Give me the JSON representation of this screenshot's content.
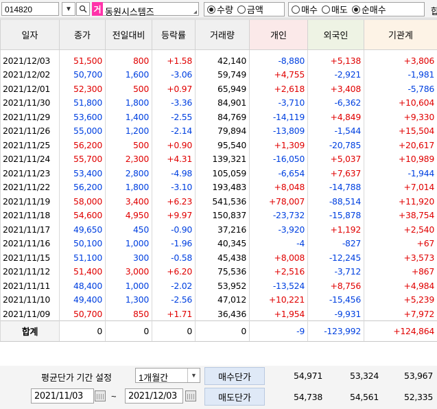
{
  "toolbar": {
    "code": "014820",
    "badge": "거",
    "name": "동원시스템즈",
    "radio_qty": "수량",
    "radio_amt": "금액",
    "radio_buy": "매수",
    "radio_sell": "매도",
    "radio_net": "순매수",
    "cut": "합"
  },
  "headers": [
    "일자",
    "종가",
    "전일대비",
    "등락률",
    "거래량",
    "개인",
    "외국인",
    "기관계"
  ],
  "rows": [
    [
      "2021/12/03",
      "51,500",
      "800",
      "+1.58",
      "42,140",
      "-8,880",
      "+5,138",
      "+3,806"
    ],
    [
      "2021/12/02",
      "50,700",
      "1,600",
      "-3.06",
      "59,749",
      "+4,755",
      "-2,921",
      "-1,981"
    ],
    [
      "2021/12/01",
      "52,300",
      "500",
      "+0.97",
      "65,949",
      "+2,618",
      "+3,408",
      "-5,786"
    ],
    [
      "2021/11/30",
      "51,800",
      "1,800",
      "-3.36",
      "84,901",
      "-3,710",
      "-6,362",
      "+10,604"
    ],
    [
      "2021/11/29",
      "53,600",
      "1,400",
      "-2.55",
      "84,769",
      "-14,119",
      "+4,849",
      "+9,330"
    ],
    [
      "2021/11/26",
      "55,000",
      "1,200",
      "-2.14",
      "79,894",
      "-13,809",
      "-1,544",
      "+15,504"
    ],
    [
      "2021/11/25",
      "56,200",
      "500",
      "+0.90",
      "95,540",
      "+1,309",
      "-20,785",
      "+20,617"
    ],
    [
      "2021/11/24",
      "55,700",
      "2,300",
      "+4.31",
      "139,321",
      "-16,050",
      "+5,037",
      "+10,989"
    ],
    [
      "2021/11/23",
      "53,400",
      "2,800",
      "-4.98",
      "105,059",
      "-6,654",
      "+7,637",
      "-1,944"
    ],
    [
      "2021/11/22",
      "56,200",
      "1,800",
      "-3.10",
      "193,483",
      "+8,048",
      "-14,788",
      "+7,014"
    ],
    [
      "2021/11/19",
      "58,000",
      "3,400",
      "+6.23",
      "541,536",
      "+78,007",
      "-88,514",
      "+11,920"
    ],
    [
      "2021/11/18",
      "54,600",
      "4,950",
      "+9.97",
      "150,837",
      "-23,732",
      "-15,878",
      "+38,754"
    ],
    [
      "2021/11/17",
      "49,650",
      "450",
      "-0.90",
      "37,216",
      "-3,920",
      "+1,192",
      "+2,540"
    ],
    [
      "2021/11/16",
      "50,100",
      "1,000",
      "-1.96",
      "40,345",
      "-4",
      "-827",
      "+67"
    ],
    [
      "2021/11/15",
      "51,100",
      "300",
      "-0.58",
      "45,438",
      "+8,008",
      "-12,245",
      "+3,573"
    ],
    [
      "2021/11/12",
      "51,400",
      "3,000",
      "+6.20",
      "75,536",
      "+2,516",
      "-3,712",
      "+867"
    ],
    [
      "2021/11/11",
      "48,400",
      "1,000",
      "-2.02",
      "53,952",
      "-13,524",
      "+8,756",
      "+4,984"
    ],
    [
      "2021/11/10",
      "49,400",
      "1,300",
      "-2.56",
      "47,012",
      "+10,221",
      "-15,456",
      "+5,239"
    ],
    [
      "2021/11/09",
      "50,700",
      "850",
      "+1.71",
      "36,436",
      "+1,954",
      "-9,931",
      "+7,972"
    ]
  ],
  "summary": [
    "합계",
    "0",
    "0",
    "0",
    "0",
    "-9",
    "-123,992",
    "+124,864"
  ],
  "bottom": {
    "period_label": "평균단가 기간 설정",
    "period_value": "1개월간",
    "buy_label": "매수단가",
    "sell_label": "매도단가",
    "buy_values": [
      "54,971",
      "53,324",
      "53,967"
    ],
    "sell_values": [
      "54,738",
      "54,561",
      "52,335"
    ],
    "start_date": "2021/11/03",
    "end_date": "2021/12/03",
    "tilde": "~"
  },
  "colors": {
    "up": "#e00000",
    "down": "#0040e0",
    "badge": "#ff33aa",
    "tag": "#dfe9f7"
  }
}
